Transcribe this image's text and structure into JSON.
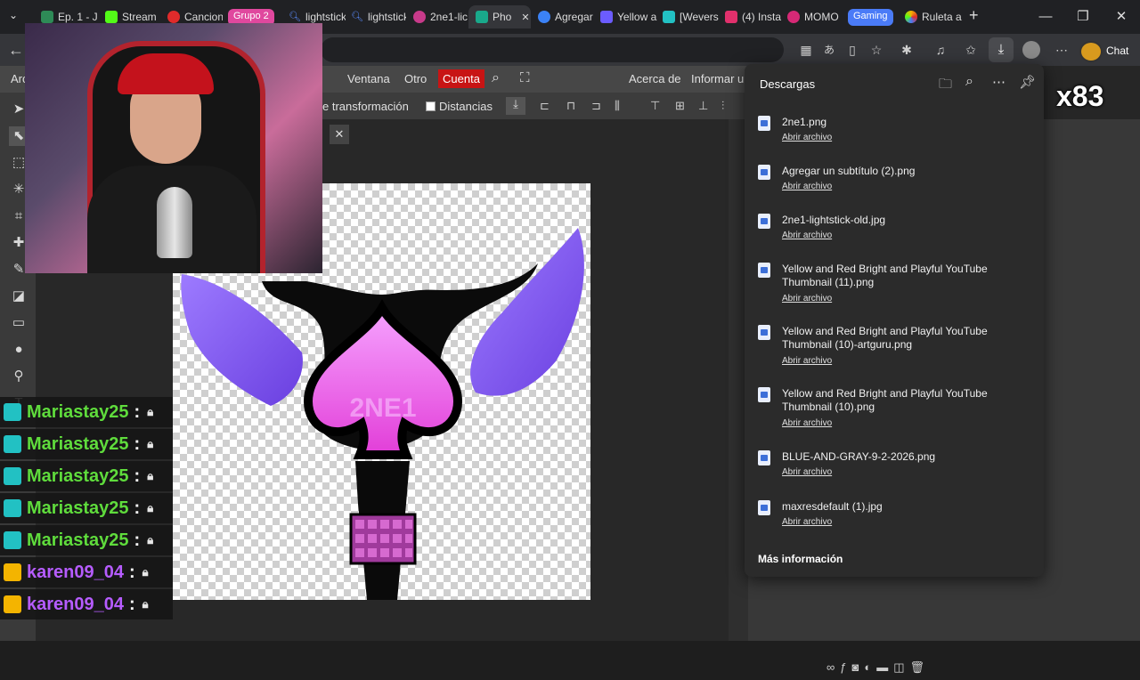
{
  "browser": {
    "tabs": [
      {
        "label": "Ep. 1 - J",
        "color": "#2e8b57"
      },
      {
        "label": "Stream",
        "color": "#53fc18"
      },
      {
        "label": "Cancion",
        "color": "#e02b2b"
      },
      {
        "label": "lightstick",
        "color": "#5b8cff"
      },
      {
        "label": "lightstick",
        "color": "#5b8cff"
      },
      {
        "label": "2ne1-lic",
        "color": "#c73a8a"
      },
      {
        "label": "Pho",
        "color": "#19a98b"
      },
      {
        "label": "Agregar",
        "color": "#3b82f6"
      },
      {
        "label": "Yellow a",
        "color": "#6b5cff"
      },
      {
        "label": "[Wevers",
        "color": "#22c1c3"
      },
      {
        "label": "(4) Insta",
        "color": "#e1306c"
      },
      {
        "label": "MOMO",
        "color": "#d62976"
      },
      {
        "label": "Ruleta a",
        "color": "#f4b400"
      }
    ],
    "group_labels": {
      "grupo2": "Grupo 2",
      "gaming": "Gaming"
    },
    "group_colors": {
      "grupo2": "#e0489e",
      "gaming": "#4a7bf7"
    },
    "new_tab": "+",
    "window_controls": {
      "minimize": "—",
      "maximize": "❐",
      "close": "✕"
    }
  },
  "photopea": {
    "menus_left": {
      "first": "Arc"
    },
    "menus": [
      "Ventana",
      "Otro"
    ],
    "account_menu": "Cuenta",
    "menus_right": [
      "Acerca de",
      "Informar u"
    ],
    "options": {
      "transform": "e transformación",
      "distances": "Distancias"
    }
  },
  "downloads": {
    "title": "Descargas",
    "items": [
      {
        "name": "2ne1.png",
        "action": "Abrir archivo"
      },
      {
        "name": "Agregar un subtítulo (2).png",
        "action": "Abrir archivo"
      },
      {
        "name": "2ne1-lightstick-old.jpg",
        "action": "Abrir archivo"
      },
      {
        "name": "Yellow and Red Bright and Playful YouTube Thumbnail (11).png",
        "action": "Abrir archivo"
      },
      {
        "name": "Yellow and Red Bright and Playful YouTube Thumbnail (10)-artguru.png",
        "action": "Abrir archivo"
      },
      {
        "name": "Yellow and Red Bright and Playful YouTube Thumbnail (10).png",
        "action": "Abrir archivo"
      },
      {
        "name": "BLUE-AND-GRAY-9-2-2026.png",
        "action": "Abrir archivo"
      },
      {
        "name": "maxresdefault (1).jpg",
        "action": "Abrir archivo"
      }
    ],
    "more_info": "Más información"
  },
  "chat_overlay": {
    "messages": [
      {
        "user": "Mariastay25",
        "sep": ":",
        "color": "#5fdc3c",
        "badge": "#22c1c3"
      },
      {
        "user": "Mariastay25",
        "sep": ":",
        "color": "#5fdc3c",
        "badge": "#22c1c3"
      },
      {
        "user": "Mariastay25",
        "sep": ":",
        "color": "#5fdc3c",
        "badge": "#22c1c3"
      },
      {
        "user": "Mariastay25",
        "sep": ":",
        "color": "#5fdc3c",
        "badge": "#22c1c3"
      },
      {
        "user": "Mariastay25",
        "sep": ":",
        "color": "#5fdc3c",
        "badge": "#22c1c3"
      },
      {
        "user": "karen09_04",
        "sep": ":",
        "color": "#b65cff",
        "badge": "#f4b400"
      },
      {
        "user": "karen09_04",
        "sep": ":",
        "color": "#b65cff",
        "badge": "#f4b400"
      }
    ]
  },
  "stream_overlay": {
    "chat_label": "Chat",
    "counter": "x83"
  },
  "canvas": {
    "stick_text": "2NE1"
  }
}
